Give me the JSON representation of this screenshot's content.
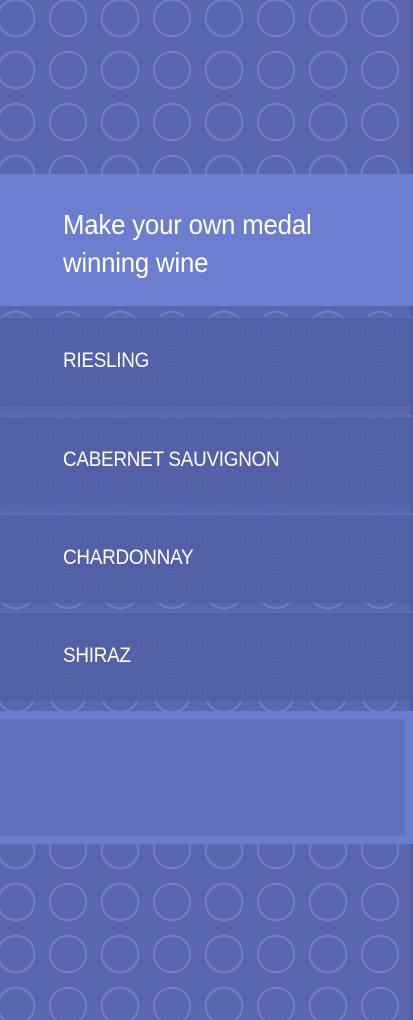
{
  "header": {
    "title_line1": "Make your own medal",
    "title_line2": "winning wine"
  },
  "wines": [
    {
      "label": "RIESLING"
    },
    {
      "label": "CABERNET SAUVIGNON"
    },
    {
      "label": "CHARDONNAY"
    },
    {
      "label": "SHIRAZ"
    }
  ],
  "colors": {
    "background": "#5a67b0",
    "banner": "#6d7ed1",
    "list_item": "#525ea4",
    "panel": "#6b7ccf",
    "text": "#ffffff"
  }
}
